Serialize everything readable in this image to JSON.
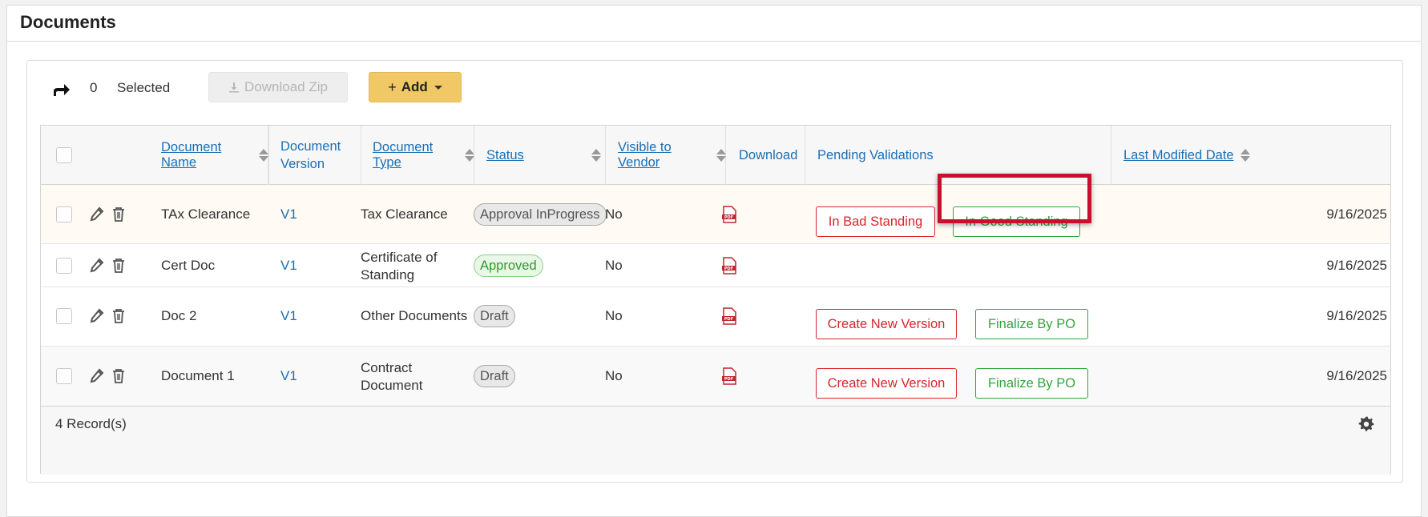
{
  "panel": {
    "title": "Documents"
  },
  "toolbar": {
    "selected_count": "0",
    "selected_label": "Selected",
    "download_zip_label": "Download Zip",
    "add_label": "Add"
  },
  "table": {
    "columns": [
      {
        "label": "Document Name",
        "sortable": true
      },
      {
        "label": "Document Version",
        "sortable": false
      },
      {
        "label": "Document Type",
        "sortable": true
      },
      {
        "label": "Status",
        "sortable": true
      },
      {
        "label": "Visible to Vendor",
        "sortable": true
      },
      {
        "label": "Download",
        "sortable": false
      },
      {
        "label": "Pending Validations",
        "sortable": false
      },
      {
        "label": "Last Modified Date",
        "sortable": true
      }
    ],
    "rows": [
      {
        "name": "TAx Clearance",
        "version": "V1",
        "type": "Tax Clearance",
        "status": "Approval InProgress",
        "visible": "No",
        "actions": [
          "In Bad Standing",
          "In Good Standing"
        ],
        "date": "9/16/2025"
      },
      {
        "name": "Cert Doc",
        "version": "V1",
        "type_line1": "Certificate of",
        "type_line2": "Standing",
        "status": "Approved",
        "visible": "No",
        "date": "9/16/2025"
      },
      {
        "name": "Doc 2",
        "version": "V1",
        "type": "Other Documents",
        "status": "Draft",
        "visible": "No",
        "actions": [
          "Create New Version",
          "Finalize By PO"
        ],
        "date": "9/16/2025"
      },
      {
        "name": "Document 1",
        "version": "V1",
        "type_line1": "Contract",
        "type_line2": "Document",
        "status": "Draft",
        "visible": "No",
        "actions": [
          "Create New Version",
          "Finalize By PO"
        ],
        "date": "9/16/2025"
      }
    ]
  },
  "footer": {
    "records_label": "4 Record(s)"
  },
  "colors": {
    "link": "#1a6fb5",
    "danger": "#d9252b",
    "success": "#2fa63a",
    "add_button": "#f0c865",
    "highlight": "#c8102e"
  }
}
